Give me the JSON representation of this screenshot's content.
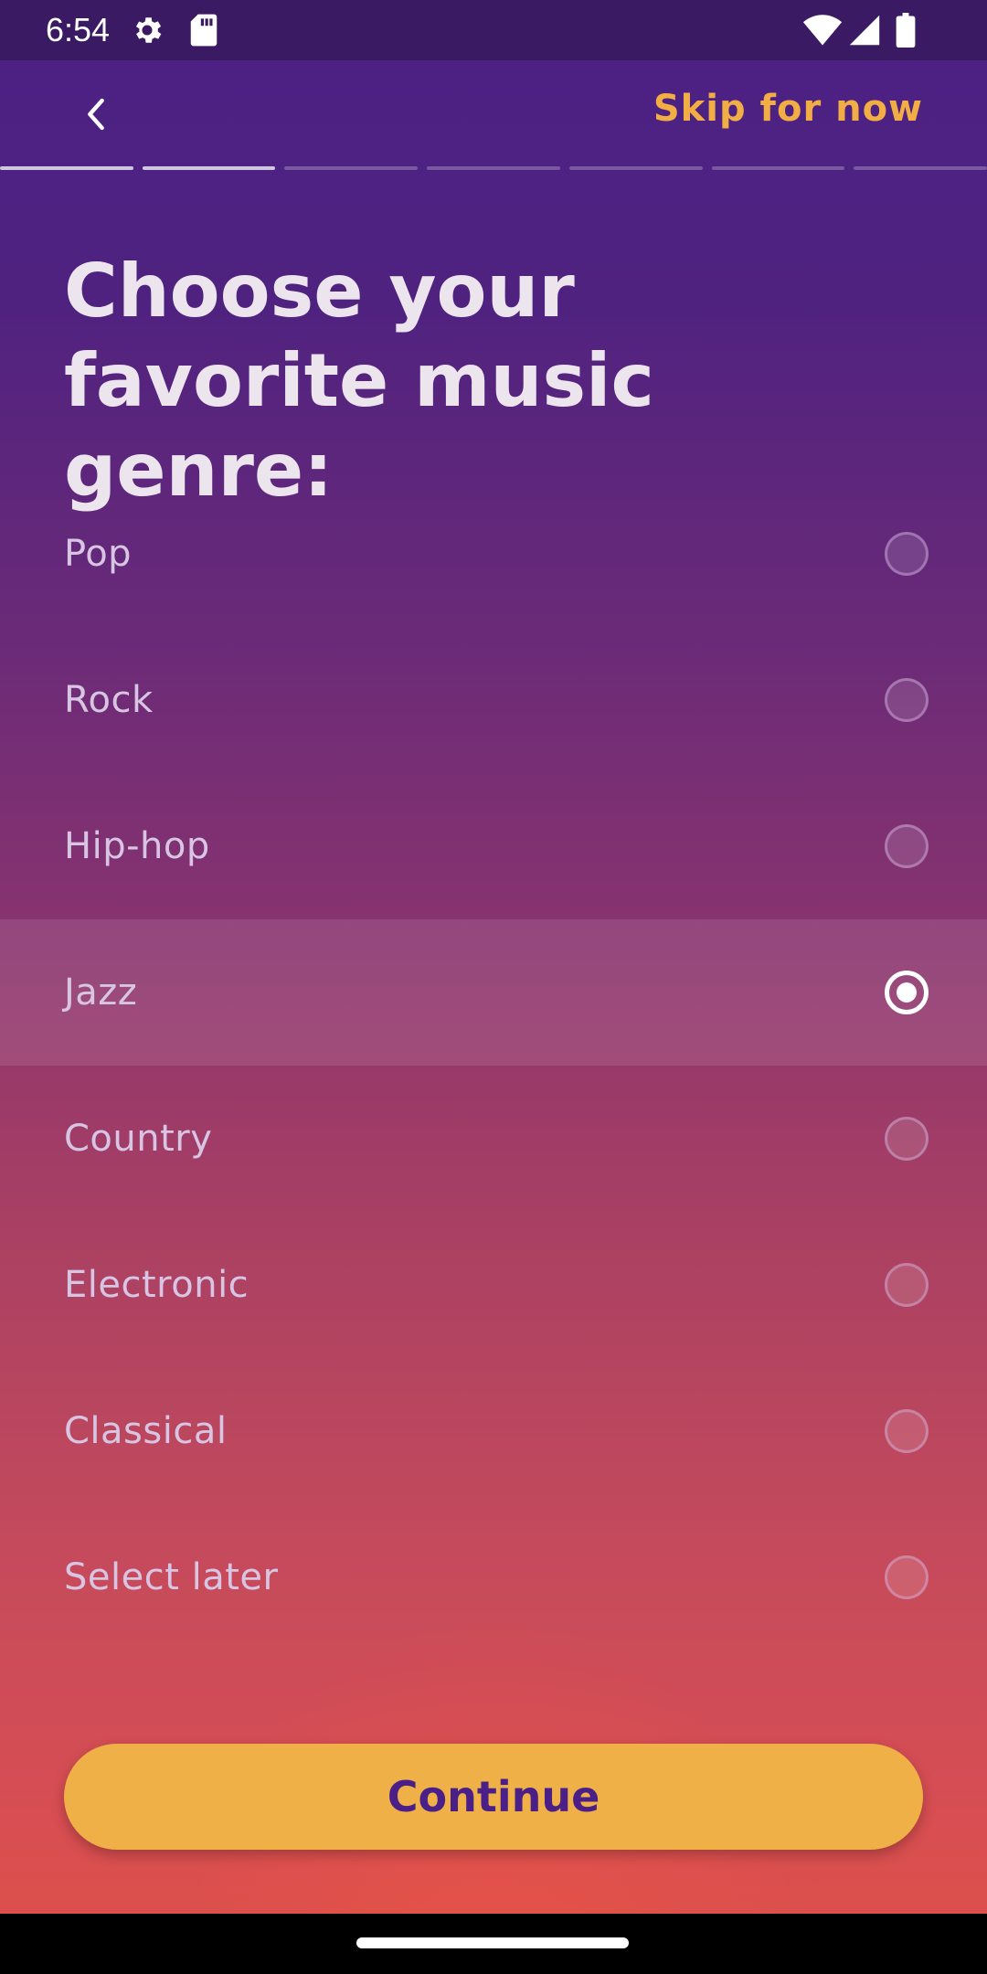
{
  "status_bar": {
    "time": "6:54",
    "icons": [
      "settings-icon",
      "sd-card-icon",
      "wifi-icon",
      "cell-signal-icon",
      "battery-icon"
    ]
  },
  "nav": {
    "back_icon": "chevron-left-icon",
    "skip_label": "Skip for now"
  },
  "progress": {
    "total_steps": 7,
    "completed_steps": 2
  },
  "title": "Choose your favorite music genre:",
  "options": [
    {
      "label": "Pop",
      "selected": false
    },
    {
      "label": "Rock",
      "selected": false
    },
    {
      "label": "Hip-hop",
      "selected": false
    },
    {
      "label": "Jazz",
      "selected": true
    },
    {
      "label": "Country",
      "selected": false
    },
    {
      "label": "Electronic",
      "selected": false
    },
    {
      "label": "Classical",
      "selected": false
    },
    {
      "label": "Select later",
      "selected": false
    }
  ],
  "continue_label": "Continue",
  "colors": {
    "accent": "#efb047",
    "skip_text": "#f2ad45",
    "button_text": "#4a2088",
    "background_top": "#4b2184",
    "background_bottom": "#de5048"
  }
}
